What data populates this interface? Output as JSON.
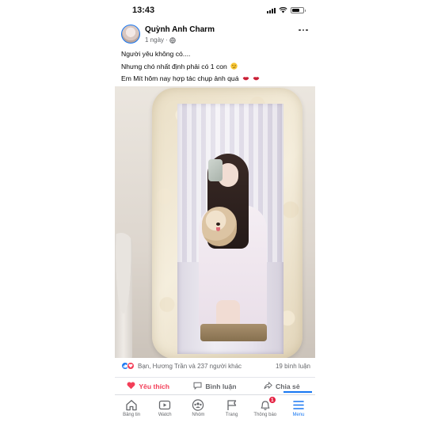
{
  "status_bar": {
    "time": "13:43"
  },
  "post": {
    "author": "Quỳnh Anh Charm",
    "time": "1 ngày",
    "dot": "·",
    "lines": [
      "Người yêu không có....",
      "Nhưng chó nhất định phải có 1 con",
      "Em Mít hôm nay hợp tác chụp ảnh quá"
    ],
    "line_emojis": [
      "",
      "smirk-emoji",
      "kiss-lips-emoji"
    ]
  },
  "reactions": {
    "icons": [
      "like-icon",
      "love-icon"
    ],
    "text": "Bạn, Hương Trần và 237 người khác",
    "comments": "19 bình luận"
  },
  "actions": [
    {
      "label": "Yêu thích",
      "icon": "heart-icon",
      "active": true
    },
    {
      "label": "Bình luận",
      "icon": "comment-icon",
      "active": false
    },
    {
      "label": "Chia sẻ",
      "icon": "share-icon",
      "active": false
    }
  ],
  "tab_bar": {
    "tabs": [
      {
        "label": "Bảng tin",
        "icon": "home-icon"
      },
      {
        "label": "Watch",
        "icon": "watch-icon"
      },
      {
        "label": "Nhóm",
        "icon": "groups-icon"
      },
      {
        "label": "Trang",
        "icon": "pages-icon"
      },
      {
        "label": "Thông báo",
        "icon": "bell-icon",
        "badge": "1"
      },
      {
        "label": "Menu",
        "icon": "menu-icon",
        "active": true
      }
    ]
  },
  "colors": {
    "accent": "#1877f2",
    "love": "#f33e58",
    "secondary_text": "#65676b",
    "badge": "#e41e3f"
  }
}
